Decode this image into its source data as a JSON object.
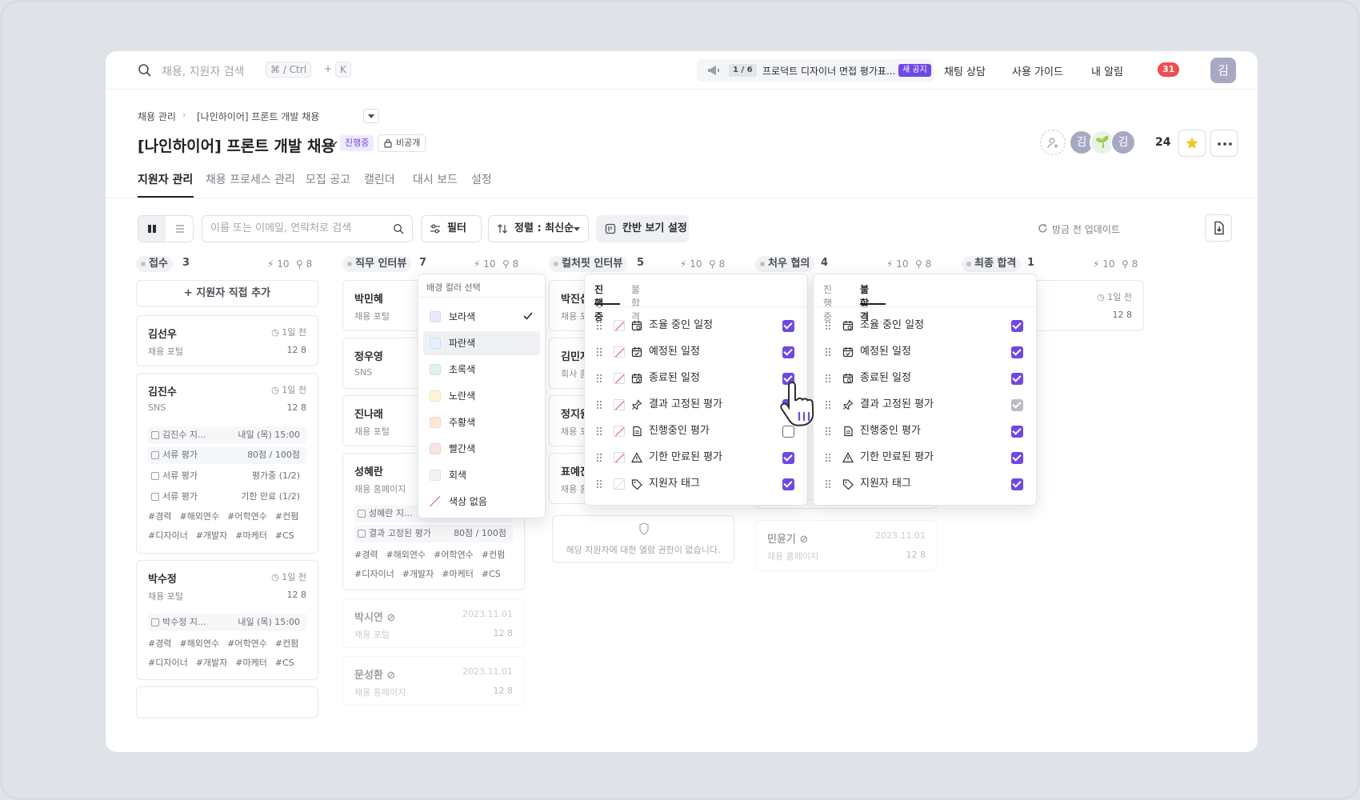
{
  "topbar": {
    "search_placeholder": "채용, 지원자 검색",
    "kbd_1": "⌘ / Ctrl",
    "plus": "+",
    "kbd_2": "K",
    "notice_pager": "1 / 6",
    "notice_text": "프로덕트 디자이너 면접 평가표...",
    "notice_badge": "새 공지",
    "links": {
      "chat": "채팅 상담",
      "guide": "사용 가이드",
      "alerts": "내 알림"
    },
    "alert_count": "31",
    "avatar": "김"
  },
  "breadcrumb": {
    "root": "채용 관리",
    "current": "[나인하이어] 프론트 개발 채용"
  },
  "header": {
    "title": "[나인하이어] 프론트 개발 채용",
    "status": "진행중",
    "visibility": "비공개",
    "members": [
      "김",
      "🌱",
      "김"
    ],
    "member_count": "24"
  },
  "tabs": [
    "지원자 관리",
    "채용 프로세스 관리",
    "모집 공고",
    "캘린더",
    "대시 보드",
    "설정"
  ],
  "toolbar": {
    "search_placeholder": "이름 또는 이메일, 연락처로 검색",
    "filter": "필터",
    "sort": "정렬 : 최신순",
    "kanban": "칸반 보기 설정",
    "update": "방금 전 업데이트"
  },
  "columns": [
    {
      "name": "접수",
      "count": "3",
      "bolt": "10",
      "people": "8"
    },
    {
      "name": "직무 인터뷰",
      "count": "7",
      "bolt": "10",
      "people": "8"
    },
    {
      "name": "컬처핏 인터뷰",
      "count": "5",
      "bolt": "10",
      "people": "8"
    },
    {
      "name": "처우 협의",
      "count": "4",
      "bolt": "10",
      "people": "8"
    },
    {
      "name": "최종 합격",
      "count": "1",
      "bolt": "10",
      "people": "8"
    }
  ],
  "col1": {
    "add_label": "+ 지원자 직접 추가",
    "c1": {
      "name": "김선우",
      "time": "1일 전",
      "source": "채용 포털",
      "stats": "12   8"
    },
    "c2": {
      "name": "김진수",
      "time": "1일 전",
      "source": "SNS",
      "stats": "12   8",
      "rows": [
        {
          "label": "김진수 지...",
          "value": "내일 (목) 15:00"
        },
        {
          "label": "서류 평가",
          "value": "80점 / 100점"
        },
        {
          "label": "서류 평가",
          "value": "평가중 (1/2)"
        },
        {
          "label": "서류 평가",
          "value": "기한 만료 (1/2)"
        }
      ],
      "tags1": [
        "#경력",
        "#해외연수",
        "#어학연수",
        "#컨펌"
      ],
      "tags2": [
        "#디자이너",
        "#개발자",
        "#마케터",
        "#CS"
      ]
    },
    "c3": {
      "name": "박수정",
      "time": "1일 전",
      "source": "채용 포털",
      "stats": "12   8",
      "rows": [
        {
          "label": "박수정 지...",
          "value": "내일 (목) 15:00"
        }
      ],
      "tags1": [
        "#경력",
        "#해외연수",
        "#어학연수",
        "#컨펌"
      ],
      "tags2": [
        "#디자이너",
        "#개발자",
        "#마케터",
        "#CS"
      ]
    }
  },
  "col2": {
    "c1": {
      "name": "박민혜",
      "source": "채용 포털"
    },
    "c2": {
      "name": "정우영",
      "source": "SNS"
    },
    "c3": {
      "name": "진나래",
      "source": "채용 포털"
    },
    "c4": {
      "name": "성혜란",
      "source": "채용 홈페이지",
      "rows": [
        {
          "label": "성혜란 지...",
          "value": ""
        },
        {
          "label": "결과 고정된 평가",
          "value": "80점 / 100점"
        }
      ],
      "tags1": [
        "#경력",
        "#해외연수",
        "#어학연수",
        "#컨펌"
      ],
      "tags2": [
        "#디자이너",
        "#개발자",
        "#마케터",
        "#CS"
      ]
    },
    "c5": {
      "name": "박시연",
      "time": "2023.11.01",
      "source": "채용 포털",
      "stats": "12   8"
    },
    "c6": {
      "name": "문성환",
      "time": "2023.11.01",
      "source": "채용 홈페이지",
      "stats": "12   8"
    }
  },
  "col3": {
    "c1": {
      "name": "박진섭",
      "source": "채용 포털"
    },
    "c2": {
      "name": "김민지",
      "source": "회사 홈페"
    },
    "c3": {
      "name": "정지원",
      "source": "채용 포털"
    },
    "c4": {
      "name": "표예진",
      "source": "채용 홈페"
    },
    "noperm": "해당 지원자에 대한 열람 권한이 없습니다."
  },
  "col4": {
    "c1": {
      "name": "민윤기",
      "time": "2023.11.01",
      "source": "채용 홈페이지",
      "stats": "12   8"
    }
  },
  "col5": {
    "c1": {
      "time": "1일 전",
      "stats": "12   8"
    }
  },
  "color_popup": {
    "title": "배경 컬러 선택",
    "options": [
      {
        "label": "보라색",
        "color": "#ebe8ff"
      },
      {
        "label": "파란색",
        "color": "#e3f0ff"
      },
      {
        "label": "초록색",
        "color": "#dff3ea"
      },
      {
        "label": "노란색",
        "color": "#fff6d6"
      },
      {
        "label": "주황색",
        "color": "#ffe9d6"
      },
      {
        "label": "빨간색",
        "color": "#ffe3e3"
      },
      {
        "label": "회색",
        "color": "#f1f2f4"
      },
      {
        "label": "색상 없음",
        "color": "#ffffff"
      }
    ],
    "selected": "보라색"
  },
  "visibility_popup": {
    "tabs": [
      "진행 중",
      "불합격"
    ],
    "items": [
      "조율 중인 일정",
      "예정된 일정",
      "종료된 일정",
      "결과 고정된 평가",
      "진행중인 평가",
      "기한 만료된 평가",
      "지원자 태그"
    ]
  },
  "colors": {
    "accent": "#6f48e6",
    "alert": "#ef4e4e"
  }
}
